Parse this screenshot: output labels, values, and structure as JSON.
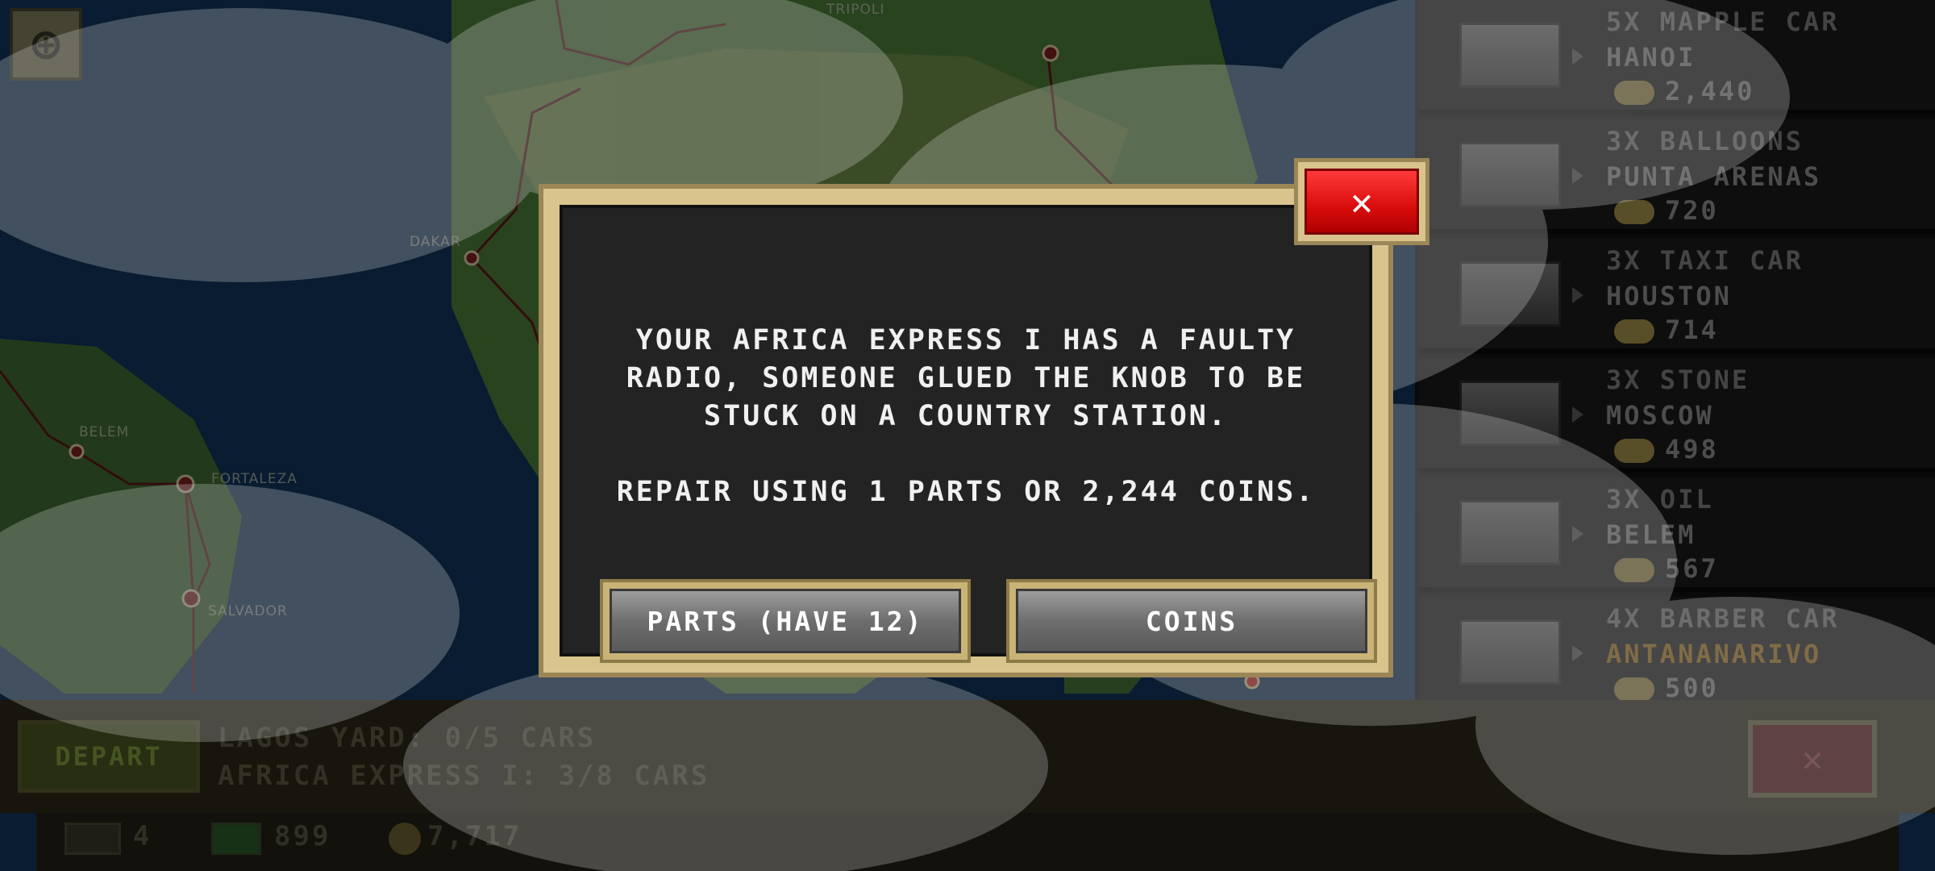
{
  "map": {
    "cities": [
      "TRIPOLI",
      "DAKAR",
      "BELEM",
      "FORTALEZA",
      "SALVADOR"
    ]
  },
  "orders": [
    {
      "name": "5X MAPPLE CAR",
      "city": "HANOI",
      "reward": "2,440",
      "city_color": "normal"
    },
    {
      "name": "3X BALLOONS",
      "city": "PUNTA ARENAS",
      "reward": "720",
      "city_color": "normal"
    },
    {
      "name": "3X TAXI CAR",
      "city": "HOUSTON",
      "reward": "714",
      "city_color": "normal"
    },
    {
      "name": "3X STONE",
      "city": "MOSCOW",
      "reward": "498",
      "city_color": "normal"
    },
    {
      "name": "3X OIL",
      "city": "BELEM",
      "reward": "567",
      "city_color": "normal"
    },
    {
      "name": "4X BARBER CAR",
      "city": "ANTANANARIVO",
      "reward": "500",
      "city_color": "gold"
    }
  ],
  "bottom_bar": {
    "depart_label": "DEPART",
    "yard_status": "LAGOS YARD: 0/5 CARS",
    "train_status": "AFRICA EXPRESS I: 3/8 CARS",
    "close_label": "✕"
  },
  "status_bar": {
    "trains": "4",
    "cash": "899",
    "coins": "7,717"
  },
  "dialog": {
    "message": "YOUR AFRICA EXPRESS I HAS A FAULTY\nRADIO, SOMEONE GLUED THE KNOB TO BE\nSTUCK ON A COUNTRY STATION.\n\nREPAIR USING 1 PARTS OR 2,244 COINS.",
    "parts_button": "PARTS (HAVE 12)",
    "coins_button": "COINS",
    "close_label": "✕"
  },
  "colors": {
    "dialog_gold": "#d8c48c",
    "close_red": "#e01010",
    "gold_text": "#b07b1e"
  }
}
